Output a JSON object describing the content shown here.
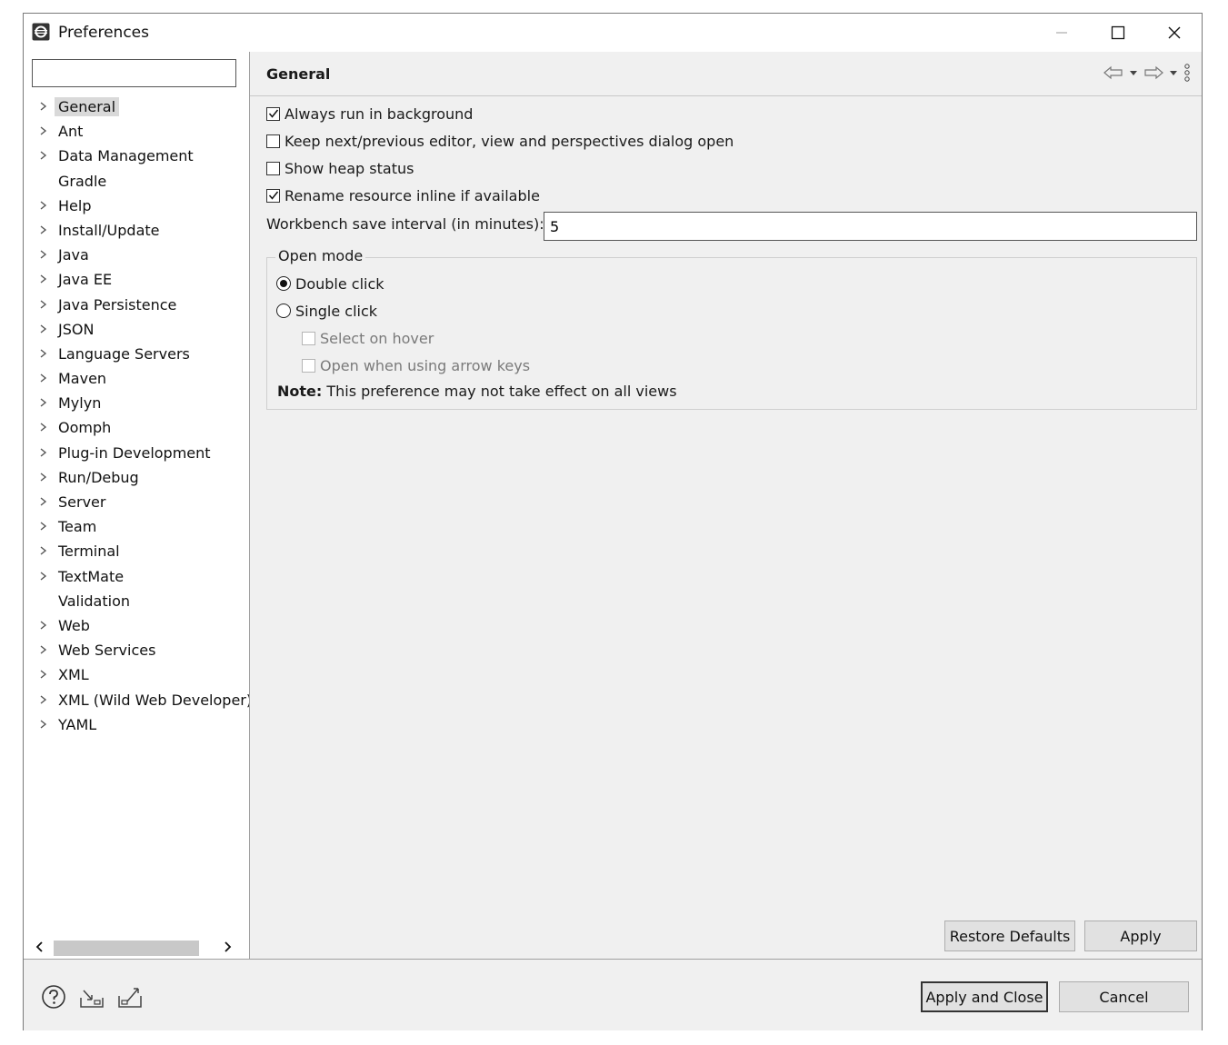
{
  "window": {
    "title": "Preferences"
  },
  "sidebar": {
    "filter_value": "",
    "items": [
      {
        "label": "General",
        "has_children": true,
        "selected": true
      },
      {
        "label": "Ant",
        "has_children": true
      },
      {
        "label": "Data Management",
        "has_children": true
      },
      {
        "label": "Gradle",
        "has_children": false
      },
      {
        "label": "Help",
        "has_children": true
      },
      {
        "label": "Install/Update",
        "has_children": true
      },
      {
        "label": "Java",
        "has_children": true
      },
      {
        "label": "Java EE",
        "has_children": true
      },
      {
        "label": "Java Persistence",
        "has_children": true
      },
      {
        "label": "JSON",
        "has_children": true
      },
      {
        "label": "Language Servers",
        "has_children": true
      },
      {
        "label": "Maven",
        "has_children": true
      },
      {
        "label": "Mylyn",
        "has_children": true
      },
      {
        "label": "Oomph",
        "has_children": true
      },
      {
        "label": "Plug-in Development",
        "has_children": true
      },
      {
        "label": "Run/Debug",
        "has_children": true
      },
      {
        "label": "Server",
        "has_children": true
      },
      {
        "label": "Team",
        "has_children": true
      },
      {
        "label": "Terminal",
        "has_children": true
      },
      {
        "label": "TextMate",
        "has_children": true
      },
      {
        "label": "Validation",
        "has_children": false
      },
      {
        "label": "Web",
        "has_children": true
      },
      {
        "label": "Web Services",
        "has_children": true
      },
      {
        "label": "XML",
        "has_children": true
      },
      {
        "label": "XML (Wild Web Developer)",
        "has_children": true
      },
      {
        "label": "YAML",
        "has_children": true
      }
    ]
  },
  "page": {
    "title": "General",
    "checkboxes": {
      "always_run_background": {
        "label": "Always run in background",
        "checked": true
      },
      "keep_dialog_open": {
        "label": "Keep next/previous editor, view and perspectives dialog open",
        "checked": false
      },
      "show_heap_status": {
        "label": "Show heap status",
        "checked": false
      },
      "rename_inline": {
        "label": "Rename resource inline if available",
        "checked": true
      }
    },
    "save_interval": {
      "label": "Workbench save interval (in minutes):",
      "value": "5"
    },
    "open_mode": {
      "legend": "Open mode",
      "double_click": {
        "label": "Double click",
        "selected": true
      },
      "single_click": {
        "label": "Single click",
        "selected": false
      },
      "select_on_hover": {
        "label": "Select on hover",
        "checked": false,
        "enabled": false
      },
      "open_arrow_keys": {
        "label": "Open when using arrow keys",
        "checked": false,
        "enabled": false
      },
      "note_label": "Note:",
      "note_text": " This preference may not take effect on all views"
    },
    "restore_defaults_label": "Restore Defaults",
    "apply_label": "Apply"
  },
  "footer": {
    "apply_close_label": "Apply and Close",
    "cancel_label": "Cancel"
  },
  "icons": [
    "eclipse-app-icon",
    "minimize-icon",
    "maximize-icon",
    "close-icon",
    "back-icon",
    "forward-icon",
    "view-menu-icon",
    "help-icon",
    "import-icon",
    "export-icon"
  ]
}
